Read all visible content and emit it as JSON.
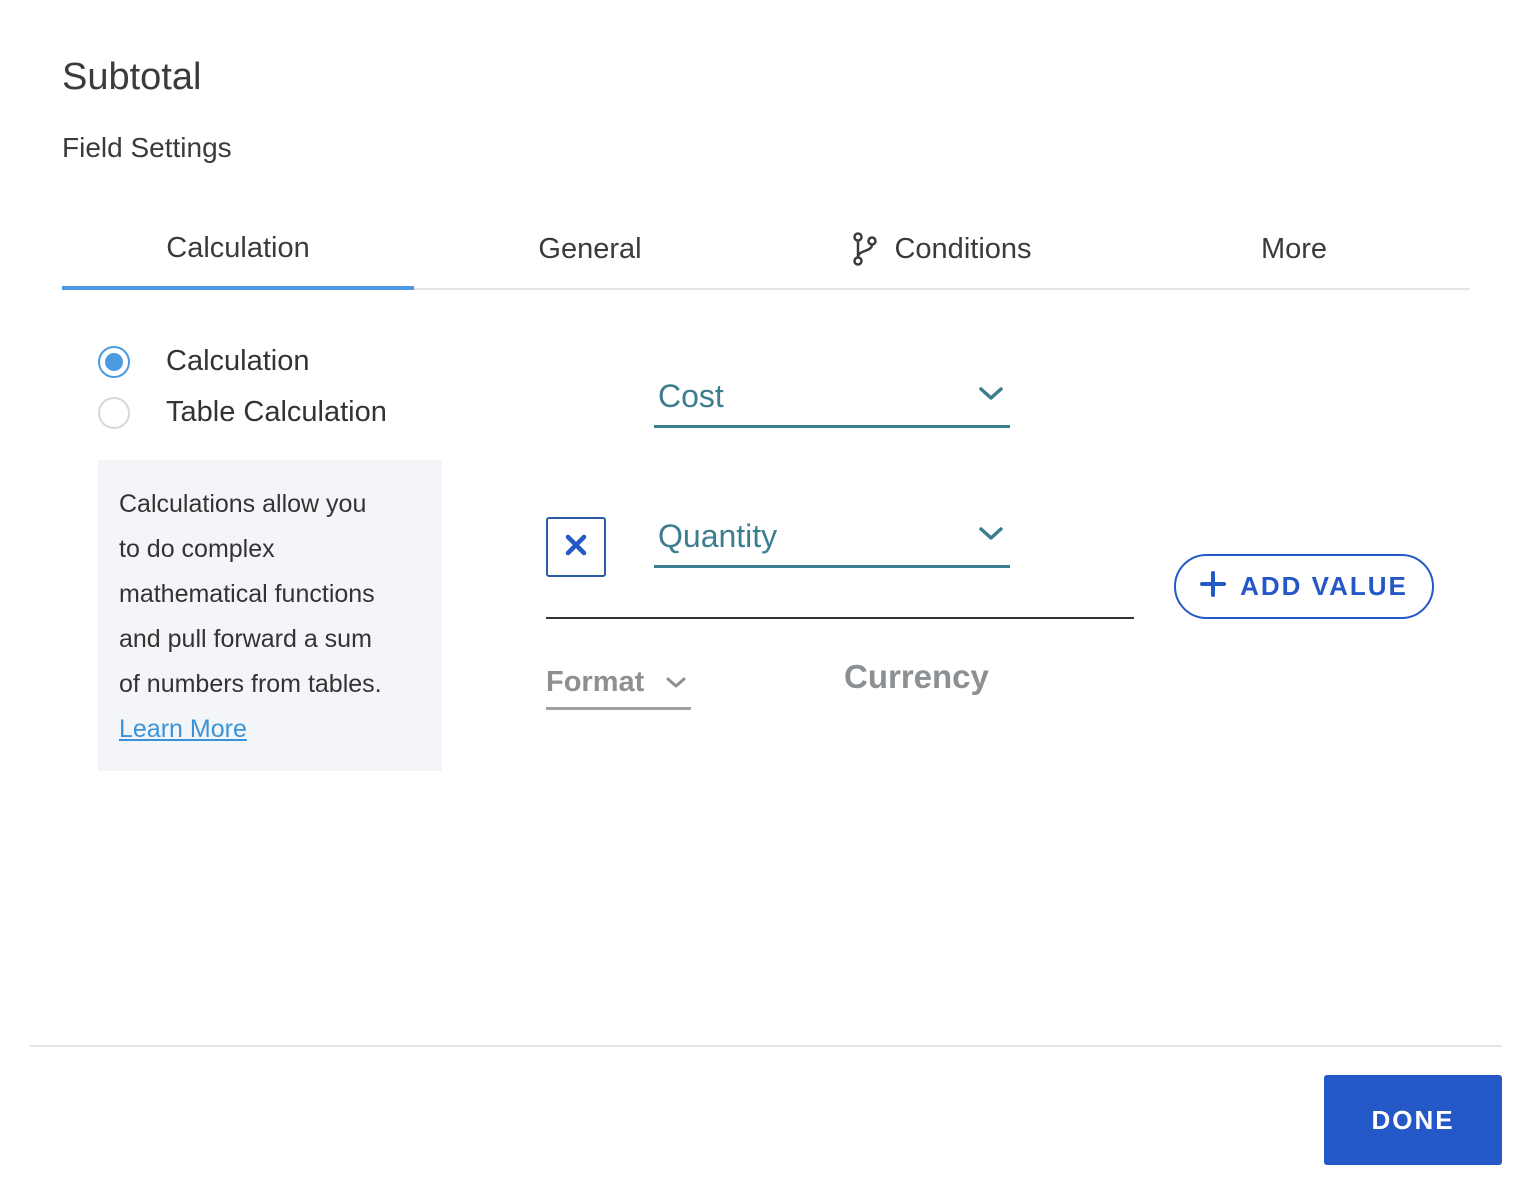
{
  "header": {
    "title": "Subtotal",
    "subtitle": "Field Settings"
  },
  "tabs": [
    {
      "label": "Calculation",
      "active": true
    },
    {
      "label": "General",
      "active": false
    },
    {
      "label": "Conditions",
      "active": false,
      "icon": "branch-icon"
    },
    {
      "label": "More",
      "active": false
    }
  ],
  "radios": [
    {
      "label": "Calculation",
      "selected": true
    },
    {
      "label": "Table Calculation",
      "selected": false
    }
  ],
  "info": {
    "lines": [
      "Calculations allow you",
      "to do complex",
      "mathematical functions",
      "and pull forward a sum",
      "of numbers from tables."
    ],
    "link": "Learn More"
  },
  "calculation": {
    "first_value": "Cost",
    "operator": "×",
    "second_value": "Quantity",
    "add_value_label": "ADD VALUE",
    "format_label": "Format",
    "format_value": "Currency"
  },
  "footer": {
    "done_label": "DONE"
  },
  "colors": {
    "accent_tab": "#4a9be2",
    "select_teal": "#3c7d8f",
    "primary_blue": "#2458c7"
  }
}
